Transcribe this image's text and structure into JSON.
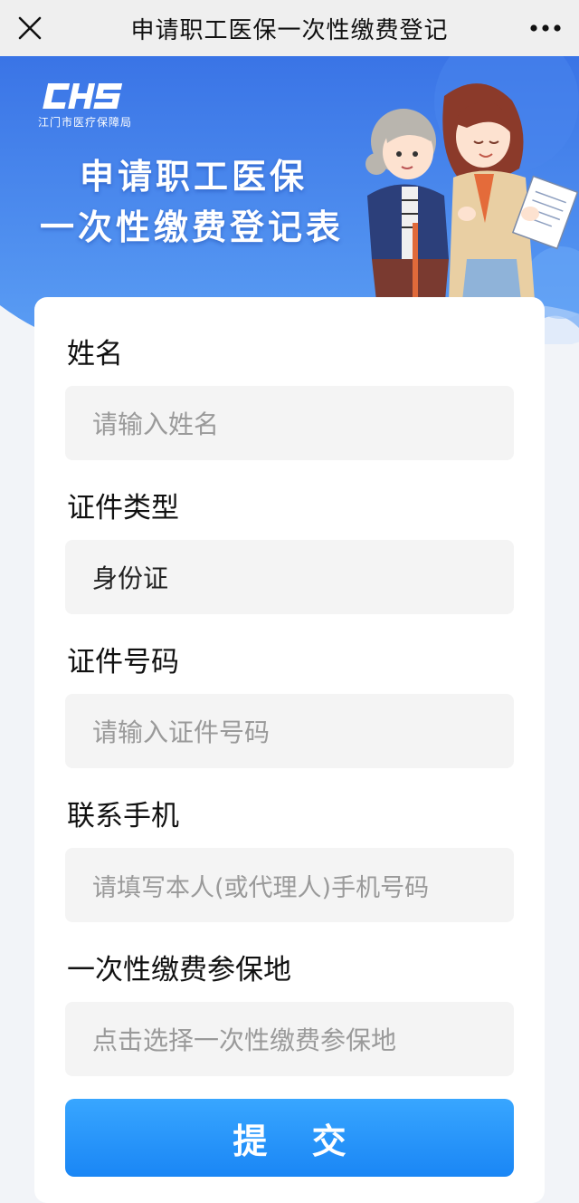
{
  "topbar": {
    "title": "申请职工医保一次性缴费登记",
    "close_icon": "close-icon",
    "more_icon": "more-dots-icon"
  },
  "banner": {
    "logo_text": "CHS",
    "logo_subtitle": "江门市医疗保障局",
    "title_line1": "申请职工医保",
    "title_line2": "一次性缴费登记表",
    "colors": {
      "blue_top": "#3a74e6",
      "blue_bottom": "#5a9cf2"
    }
  },
  "form": {
    "name": {
      "label": "姓名",
      "placeholder": "请输入姓名"
    },
    "id_type": {
      "label": "证件类型",
      "value": "身份证"
    },
    "id_number": {
      "label": "证件号码",
      "placeholder": "请输入证件号码"
    },
    "phone": {
      "label": "联系手机",
      "placeholder": "请填写本人(或代理人)手机号码"
    },
    "location": {
      "label": "一次性缴费参保地",
      "placeholder": "点击选择一次性缴费参保地"
    }
  },
  "submit": {
    "label": "提 交",
    "color": "#1a86f5"
  }
}
